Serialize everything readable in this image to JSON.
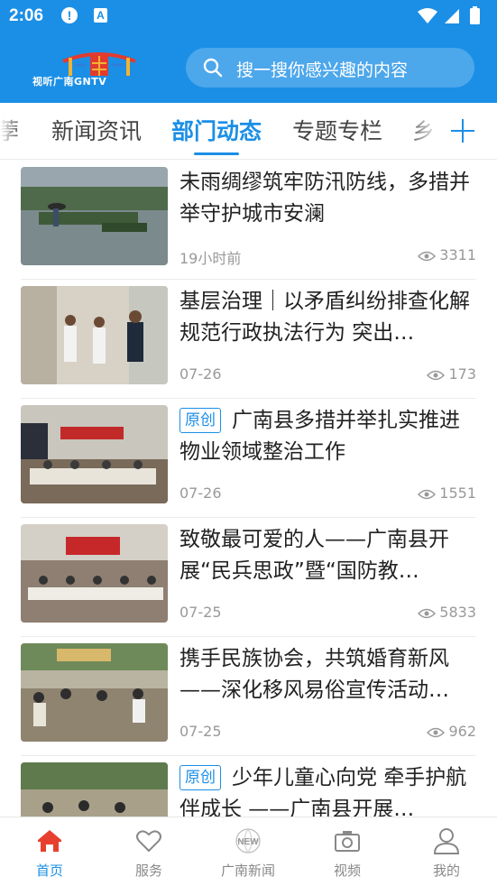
{
  "status": {
    "time": "2:06",
    "alert_glyph": "!",
    "a_glyph": "A"
  },
  "header": {
    "logo_text": "视听广南GNTV",
    "search_placeholder": "搜一搜你感兴趣的内容"
  },
  "tabs": [
    {
      "label": "荸"
    },
    {
      "label": "新闻资讯"
    },
    {
      "label": "部门动态",
      "active": true
    },
    {
      "label": "专题专栏"
    },
    {
      "label": "乡"
    }
  ],
  "articles": [
    {
      "title": "未雨绸缪筑牢防汛防线，多措并举守护城市安澜",
      "badge": "",
      "date": "19小时前",
      "views": "3311"
    },
    {
      "title": "基层治理｜以矛盾纠纷排查化解 规范行政执法行为 突出…",
      "badge": "",
      "date": "07-26",
      "views": "173"
    },
    {
      "title": "广南县多措并举扎实推进物业领域整治工作",
      "badge": "原创",
      "date": "07-26",
      "views": "1551"
    },
    {
      "title": "致敬最可爱的人——广南县开展“民兵思政”暨“国防教…",
      "badge": "",
      "date": "07-25",
      "views": "5833"
    },
    {
      "title": "携手民族协会，共筑婚育新风——深化移风易俗宣传活动…",
      "badge": "",
      "date": "07-25",
      "views": "962"
    },
    {
      "title": "少年儿童心向党 牵手护航伴成长 ——广南县开展…",
      "badge": "原创",
      "date": "",
      "views": ""
    }
  ],
  "nav": [
    {
      "label": "首页",
      "icon": "home-icon",
      "active": true
    },
    {
      "label": "服务",
      "icon": "heart-icon"
    },
    {
      "label": "广南新闻",
      "icon": "news-globe-icon"
    },
    {
      "label": "视频",
      "icon": "camera-icon"
    },
    {
      "label": "我的",
      "icon": "user-icon"
    }
  ],
  "colors": {
    "primary": "#1b8fe6",
    "text": "#222222",
    "muted": "#999999"
  }
}
